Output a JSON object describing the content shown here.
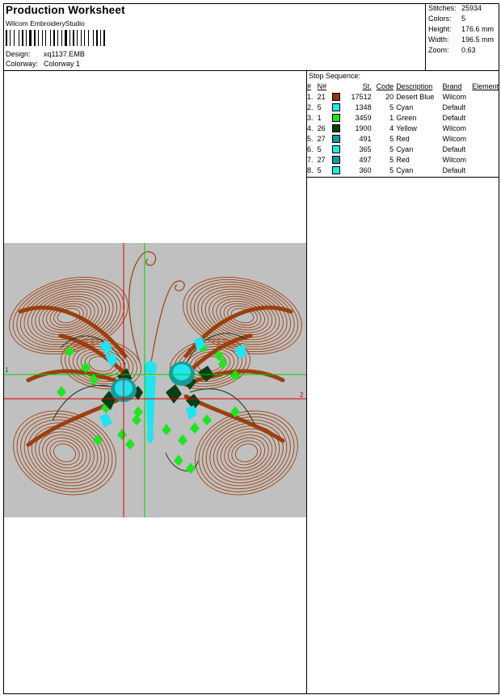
{
  "header": {
    "title": "Production Worksheet",
    "software": "Wilcom EmbroideryStudio",
    "design_label": "Design:",
    "design_value": "xq1137.EMB",
    "colorway_label": "Colorway:",
    "colorway_value": "Colorway 1"
  },
  "stats": {
    "stitches_label": "Stitches:",
    "stitches_value": "25934",
    "colors_label": "Colors:",
    "colors_value": "5",
    "height_label": "Height:",
    "height_value": "176.6 mm",
    "width_label": "Width:",
    "width_value": "196.5 mm",
    "zoom_label": "Zoom:",
    "zoom_value": "0.63"
  },
  "stop_sequence": {
    "title": "Stop Sequence:",
    "headers": [
      "#",
      "N#",
      "St.",
      "Code",
      "Description",
      "Brand",
      "Element"
    ],
    "rows": [
      {
        "num": "1.",
        "n": "21",
        "color": "#8b3a0e",
        "st": "17512",
        "code": "20",
        "desc": "Desert Blue",
        "brand": "Wilcom"
      },
      {
        "num": "2.",
        "n": "5",
        "color": "#22e3f0",
        "st": "1348",
        "code": "5",
        "desc": "Cyan",
        "brand": "Default"
      },
      {
        "num": "3.",
        "n": "1",
        "color": "#22e322",
        "st": "3459",
        "code": "1",
        "desc": "Green",
        "brand": "Default"
      },
      {
        "num": "4.",
        "n": "26",
        "color": "#0d3d14",
        "st": "1900",
        "code": "4",
        "desc": "Yellow",
        "brand": "Wilcom"
      },
      {
        "num": "5.",
        "n": "27",
        "color": "#1a9a96",
        "st": "491",
        "code": "5",
        "desc": "Red",
        "brand": "Wilcom"
      },
      {
        "num": "6.",
        "n": "5",
        "color": "#22e3f0",
        "st": "365",
        "code": "5",
        "desc": "Cyan",
        "brand": "Default"
      },
      {
        "num": "7.",
        "n": "27",
        "color": "#1a9a96",
        "st": "497",
        "code": "5",
        "desc": "Red",
        "brand": "Wilcom"
      },
      {
        "num": "8.",
        "n": "5",
        "color": "#22e3f0",
        "st": "360",
        "code": "5",
        "desc": "Cyan",
        "brand": "Default"
      }
    ]
  },
  "preview": {
    "axis_label_v": "1",
    "axis_label_h": "2",
    "colors": {
      "background": "#c0c0c0",
      "thread_brown": "#a0400c",
      "cyan": "#22e3f0",
      "green": "#22e322",
      "dark_green": "#0d3d14",
      "teal": "#1a9a96",
      "axis_red": "#e00000",
      "axis_green": "#00d000"
    }
  }
}
